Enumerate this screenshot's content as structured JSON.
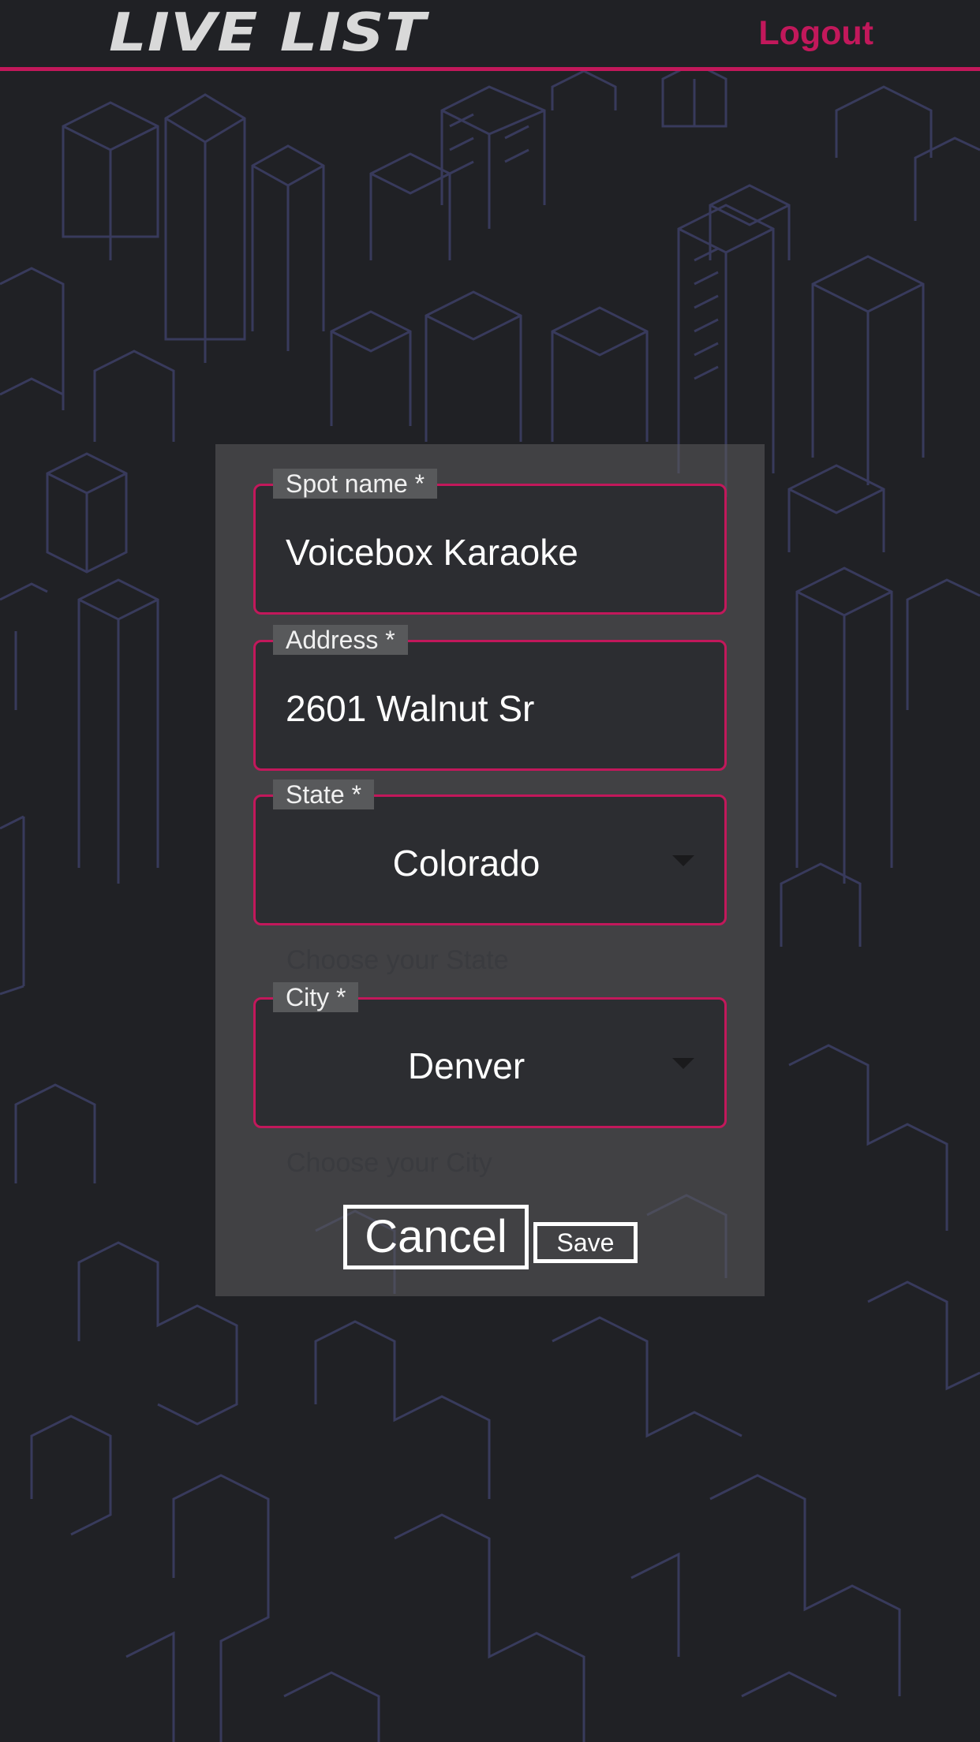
{
  "header": {
    "logo_text": "LIVE LIST",
    "logout_label": "Logout"
  },
  "form": {
    "spot_name": {
      "label": "Spot name *",
      "value": "Voicebox Karaoke"
    },
    "address": {
      "label": "Address *",
      "value": "2601 Walnut Sr"
    },
    "state": {
      "label": "State *",
      "value": "Colorado",
      "helper": "Choose your State"
    },
    "city": {
      "label": "City *",
      "value": "Denver",
      "helper": "Choose your City"
    },
    "cancel_label": "Cancel",
    "save_label": "Save"
  },
  "icons": {
    "state_dropdown": "chevron-down-icon",
    "city_dropdown": "chevron-down-icon"
  },
  "colors": {
    "accent": "#c2185b",
    "background": "#202125",
    "panel": "#58595b",
    "field_bg": "#2c2d31",
    "logo": "#d9d9d9"
  }
}
